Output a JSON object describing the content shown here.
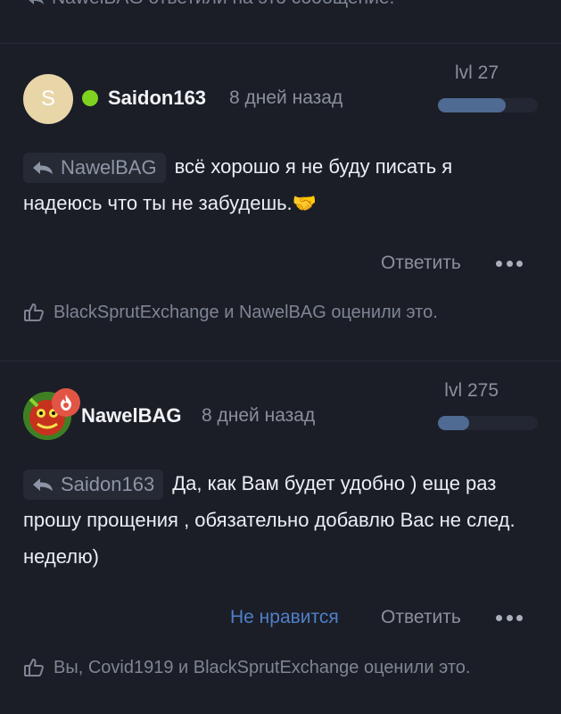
{
  "top_partial": {
    "text": "NawelBAG ответили на это сообщение."
  },
  "posts": [
    {
      "avatar_letter": "S",
      "username": "Saidon163",
      "time": "8 дней назад",
      "level": "lvl 27",
      "level_progress": 0.68,
      "quote_user": "NawelBAG",
      "text": "всё хорошо я не буду писать я надеюсь что ты не забудешь.🤝",
      "actions": {
        "reply": "Ответить"
      },
      "likes": "BlackSprutExchange и NawelBAG оценили это."
    },
    {
      "username": "NawelBAG",
      "time": "8 дней назад",
      "level": "lvl 275",
      "level_progress": 0.31,
      "quote_user": "Saidon163",
      "text": "Да, как Вам будет удобно ) еще раз прошу прощения , обязательно добавлю Вас не след. неделю)",
      "actions": {
        "dislike": "Не нравится",
        "reply": "Ответить"
      },
      "likes": "Вы, Covid1919 и BlackSprutExchange оценили это."
    }
  ],
  "colors": {
    "online": "#7ed321",
    "level_fill": "#4f6a93",
    "dislike": "#4f7fc8",
    "background": "#1b1e27"
  }
}
